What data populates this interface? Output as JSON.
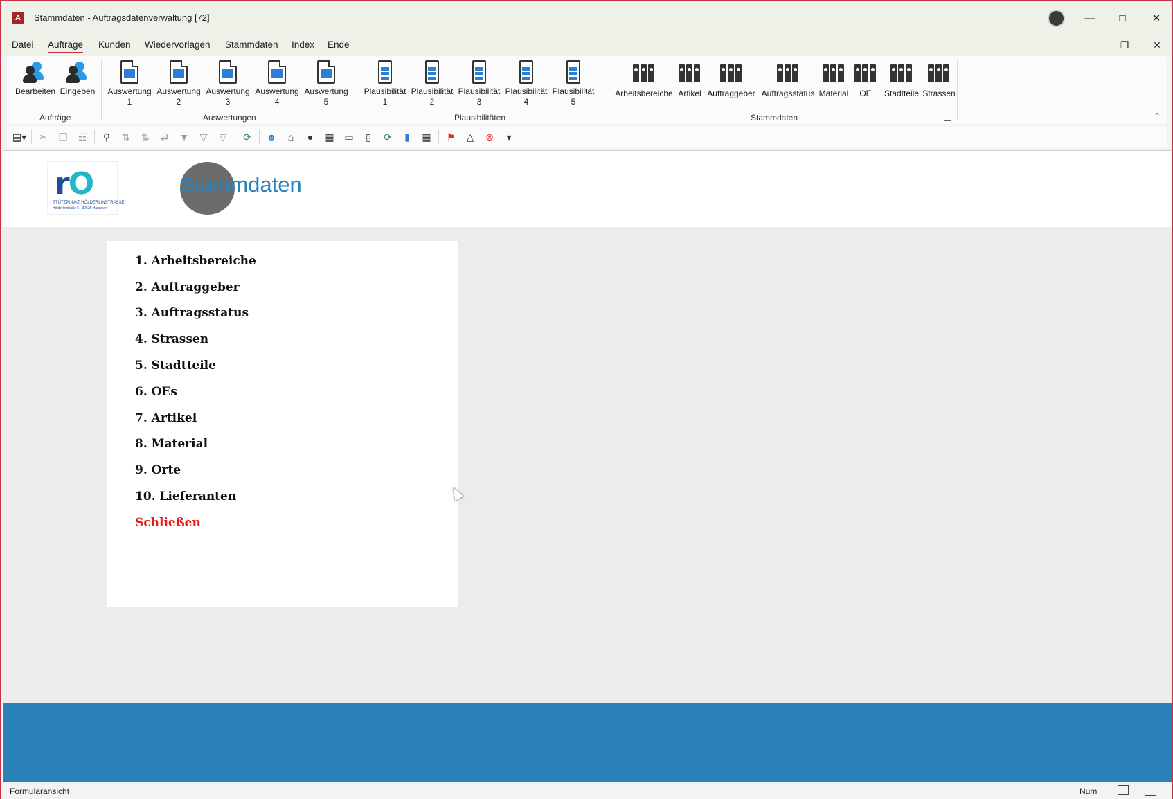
{
  "window": {
    "title": "Stammdaten  -  Auftragsdatenverwaltung [72]",
    "app_icon": "A"
  },
  "menubar": {
    "items": [
      "Datei",
      "Aufträge",
      "Kunden",
      "Wiedervorlagen",
      "Stammdaten",
      "Index",
      "Ende"
    ],
    "active": "Aufträge"
  },
  "ribbon": {
    "groups": {
      "auftraege": {
        "label": "Aufträge",
        "buttons": [
          "Bearbeiten",
          "Eingeben"
        ]
      },
      "auswertungen": {
        "label": "Auswertungen",
        "buttons": [
          "Auswertung 1",
          "Auswertung 2",
          "Auswertung 3",
          "Auswertung 4",
          "Auswertung 5"
        ]
      },
      "plausibilitaeten": {
        "label": "Plausibilitäten",
        "buttons": [
          "Plausibilität 1",
          "Plausibilität 2",
          "Plausibilität 3",
          "Plausibilität 4",
          "Plausibilität 5"
        ]
      },
      "stammdaten": {
        "label": "Stammdaten",
        "buttons": [
          "Arbeitsbereiche",
          "Artikel",
          "Auftraggeber",
          "Auftragsstatus",
          "Material",
          "OE",
          "Stadtteile",
          "Strassen"
        ]
      }
    },
    "rb": {
      "bearbeiten": "Bearbeiten",
      "eingeben": "Eingeben",
      "aw1a": "Auswertung",
      "aw1b": "1",
      "aw2a": "Auswertung",
      "aw2b": "2",
      "aw3a": "Auswertung",
      "aw3b": "3",
      "aw4a": "Auswertung",
      "aw4b": "4",
      "aw5a": "Auswertung",
      "aw5b": "5",
      "pl1a": "Plausibilität",
      "pl1b": "1",
      "pl2a": "Plausibilität",
      "pl2b": "2",
      "pl3a": "Plausibilität",
      "pl3b": "3",
      "pl4a": "Plausibilität",
      "pl4b": "4",
      "pl5a": "Plausibilität",
      "pl5b": "5",
      "sd1": "Arbeitsbereiche",
      "sd2": "Artikel",
      "sd3": "Auftraggeber",
      "sd4": "Auftragsstatus",
      "sd5": "Material",
      "sd6": "OE",
      "sd7": "Stadtteile",
      "sd8": "Strassen"
    }
  },
  "form": {
    "title": "Stammdaten",
    "logo": {
      "letters": "rO",
      "line1": "STÜTZPUNKT HÖLDERLINSTRASSE",
      "line2": "Hölderlinstraße 6 · 30625 Hannover"
    },
    "menu": {
      "m1": "1. Arbeitsbereiche",
      "m2": "2. Auftraggeber",
      "m3": "3. Auftragsstatus",
      "m4": "4. Strassen",
      "m5": "5. Stadtteile",
      "m6": "6. OEs",
      "m7": "7. Artikel",
      "m8": "8. Material",
      "m9": "9. Orte",
      "m10": "10. Lieferanten",
      "close": "Schließen"
    }
  },
  "statusbar": {
    "view": "Formularansicht",
    "num": "Num"
  },
  "colors": {
    "accent": "#2a82b9",
    "close_link": "#e41a1a",
    "active_tab_underline": "#c4314b"
  }
}
